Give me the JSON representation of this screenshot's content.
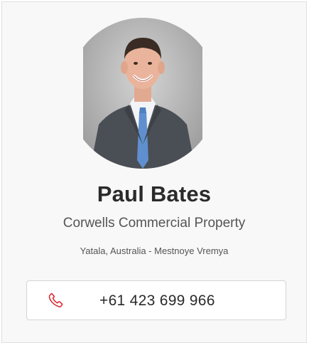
{
  "contact": {
    "name": "Paul Bates",
    "company": "Corwells Commercial Property",
    "location": "Yatala, Australia - Mestnoye Vremya",
    "phone": "+61 423 699 966"
  },
  "icons": {
    "phone": "phone-icon"
  },
  "colors": {
    "card_background": "#f8f8f8",
    "phone_icon": "#d9262d",
    "name_text": "#2a2a2a",
    "secondary_text": "#555555"
  }
}
